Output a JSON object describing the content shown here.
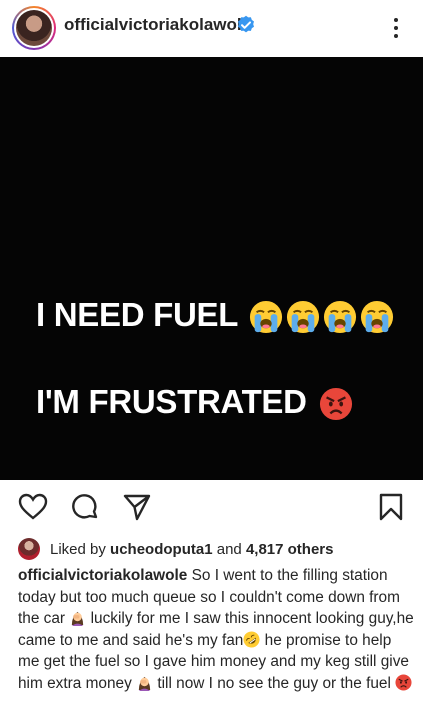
{
  "header": {
    "username": "officialvictoriakolawole",
    "verified": true,
    "more_icon": "more-vertical-icon"
  },
  "post": {
    "background": "#050505",
    "line1_text": "I NEED FUEL",
    "line1_emojis": [
      "loudly-crying-face",
      "loudly-crying-face",
      "loudly-crying-face",
      "loudly-crying-face"
    ],
    "line2_text": "I'M FRUSTRATED",
    "line2_emojis": [
      "angry-face"
    ]
  },
  "actions": {
    "like_icon": "heart-outline-icon",
    "comment_icon": "comment-icon",
    "share_icon": "send-icon",
    "save_icon": "bookmark-icon"
  },
  "likes": {
    "prefix": "Liked by",
    "liker": "ucheodoputa1",
    "conjunction": "and",
    "others": "4,817 others"
  },
  "caption": {
    "username": "officialvictoriakolawole",
    "part1": "So I went to the filling station today but too much queue so I couldn't come down from the car",
    "part2": "luckily for me I saw this innocent looking guy,he came to me and said he's my fan",
    "part3": "he promise to help me get the fuel so I gave him money and my keg still give him extra money",
    "part4": "till now I no see the guy or the fuel",
    "emojis": [
      "woman-facepalming",
      "rolling-on-floor-laughing",
      "woman-facepalming",
      "angry-face"
    ]
  },
  "colors": {
    "text": "#262626",
    "verified_blue": "#3897f0",
    "emoji_yellow": "#ffcc33",
    "emoji_angry": "#e8463a"
  }
}
